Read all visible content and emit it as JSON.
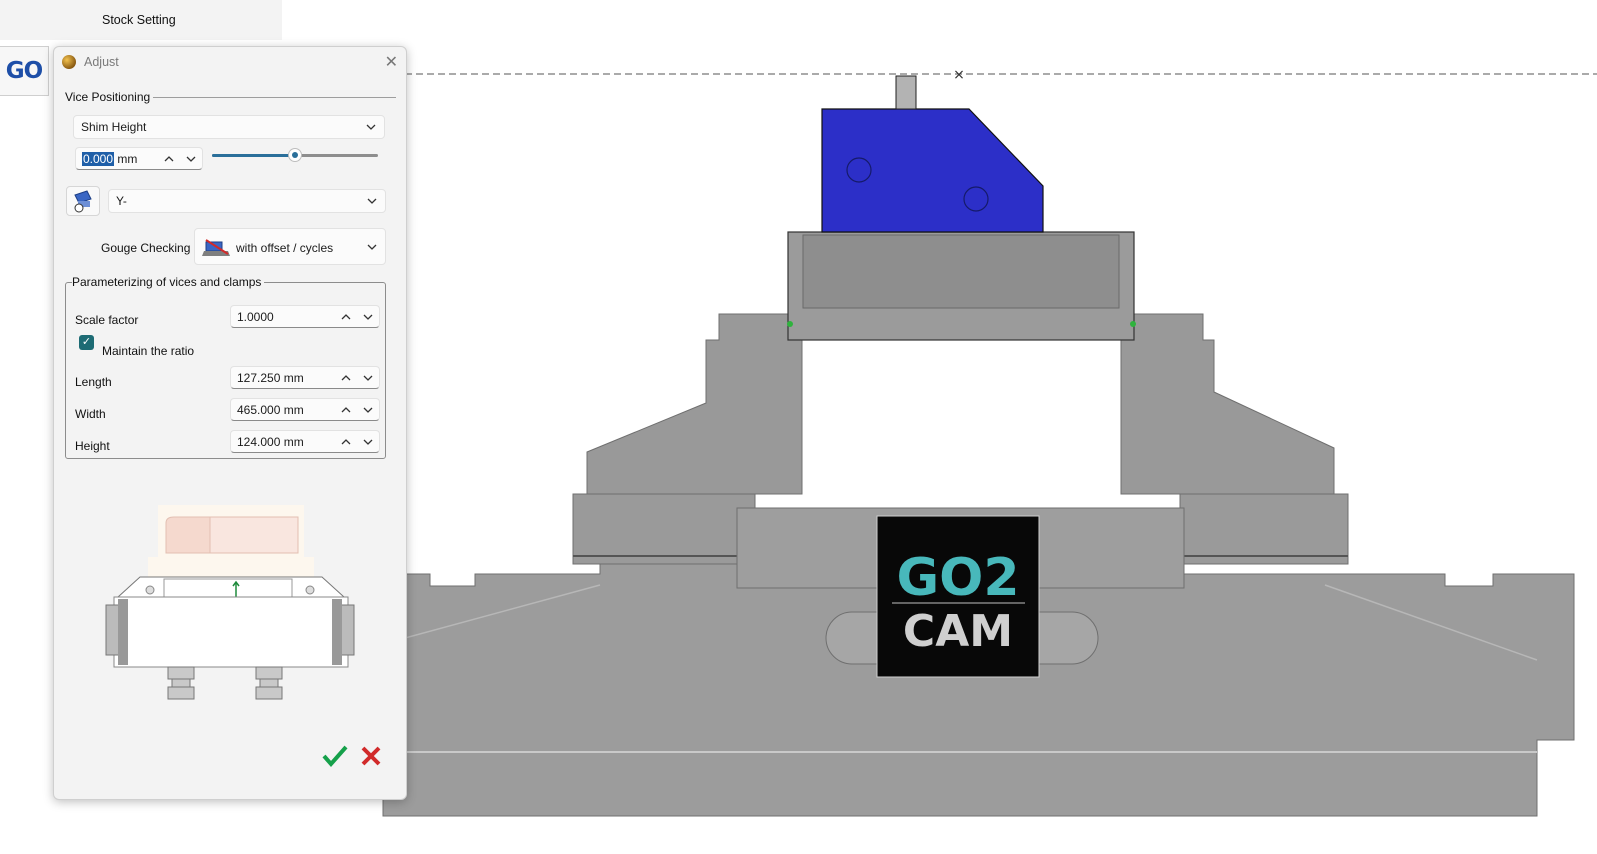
{
  "header": {
    "title": "Stock Setting",
    "tab_logo": "GO"
  },
  "dialog": {
    "title": "Adjust",
    "vice_positioning": {
      "group_label": "Vice Positioning",
      "mode_select": "Shim Height",
      "shim_value": "0.000",
      "shim_unit": "mm",
      "slider_fraction": 0.5,
      "direction_select": "Y-"
    },
    "gouge_checking": {
      "label": "Gouge Checking",
      "value": "with offset / cycles"
    },
    "parameterizing": {
      "group_label": "Parameterizing of vices and clamps",
      "scale_factor_label": "Scale factor",
      "scale_factor_value": "1.0000",
      "maintain_ratio_label": "Maintain the ratio",
      "maintain_ratio_checked": true,
      "length_label": "Length",
      "length_value": "127.250 mm",
      "width_label": "Width",
      "width_value": "465.000 mm",
      "height_label": "Height",
      "height_value": "124.000 mm"
    },
    "icons": {
      "close": "close-icon",
      "ok": "checkmark-icon",
      "cancel": "cross-icon"
    }
  },
  "viewport": {
    "logo_line1": "GO2",
    "logo_line2": "CAM"
  },
  "colors": {
    "vice_gray": "#9a9a9a",
    "part_blue": "#2c2fc8",
    "logo_teal": "#48b8bb",
    "ok_green": "#15a04a",
    "cancel_red": "#d12a2a"
  }
}
